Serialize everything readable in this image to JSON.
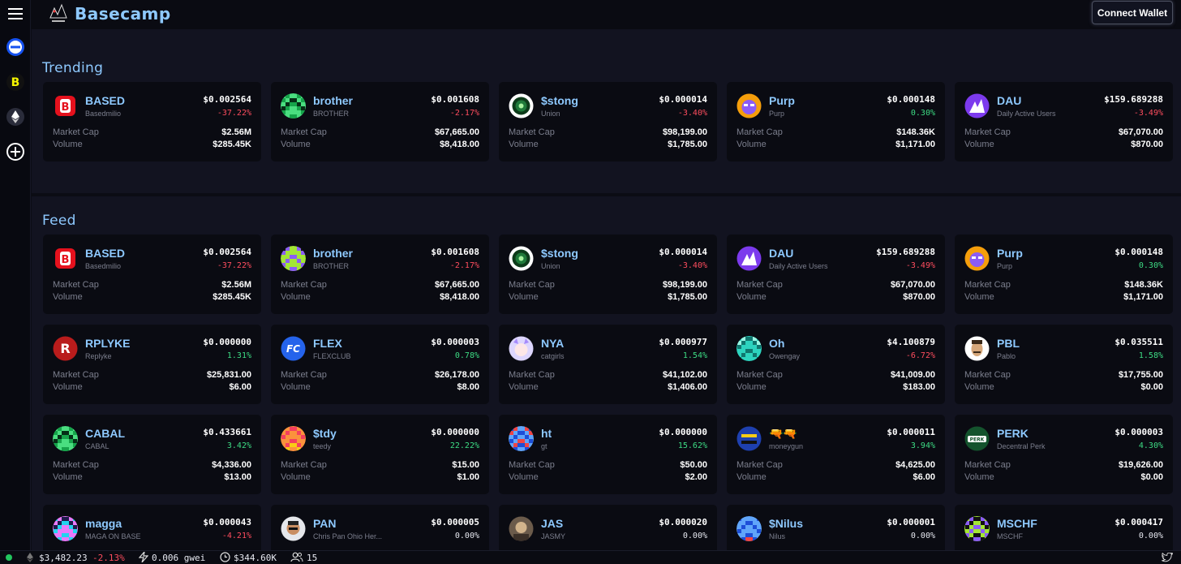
{
  "app": {
    "title": "Basecamp",
    "connect_label": "Connect Wallet"
  },
  "sections": {
    "trending": "Trending",
    "feed": "Feed"
  },
  "labels": {
    "market_cap": "Market Cap",
    "volume": "Volume"
  },
  "trending": [
    {
      "name": "BASED",
      "sub": "Basedmilio",
      "price": "$0.002564",
      "change": "-37.22%",
      "dir": "down",
      "mcap": "$2.56M",
      "vol": "$285.45K",
      "icon": "based-logo-icon"
    },
    {
      "name": "brother",
      "sub": "BROTHER",
      "price": "$0.001608",
      "change": "-2.17%",
      "dir": "down",
      "mcap": "$67,665.00",
      "vol": "$8,418.00",
      "icon": "pixel-avatar-icon"
    },
    {
      "name": "$stong",
      "sub": "Union",
      "price": "$0.000014",
      "change": "-3.40%",
      "dir": "down",
      "mcap": "$98,199.00",
      "vol": "$1,785.00",
      "icon": "stong-logo-icon"
    },
    {
      "name": "Purp",
      "sub": "Purp",
      "price": "$0.000148",
      "change": "0.30%",
      "dir": "up",
      "mcap": "$148.36K",
      "vol": "$1,171.00",
      "icon": "purp-avatar-icon"
    },
    {
      "name": "DAU",
      "sub": "Daily Active Users",
      "price": "$159.689288",
      "change": "-3.49%",
      "dir": "down",
      "mcap": "$67,070.00",
      "vol": "$870.00",
      "icon": "dau-logo-icon"
    }
  ],
  "feed": [
    {
      "name": "BASED",
      "sub": "Basedmilio",
      "price": "$0.002564",
      "change": "-37.22%",
      "dir": "down",
      "mcap": "$2.56M",
      "vol": "$285.45K",
      "icon": "based-logo-icon"
    },
    {
      "name": "brother",
      "sub": "BROTHER",
      "price": "$0.001608",
      "change": "-2.17%",
      "dir": "down",
      "mcap": "$67,665.00",
      "vol": "$8,418.00",
      "icon": "pixel-avatar-icon"
    },
    {
      "name": "$stong",
      "sub": "Union",
      "price": "$0.000014",
      "change": "-3.40%",
      "dir": "down",
      "mcap": "$98,199.00",
      "vol": "$1,785.00",
      "icon": "stong-logo-icon"
    },
    {
      "name": "DAU",
      "sub": "Daily Active Users",
      "price": "$159.689288",
      "change": "-3.49%",
      "dir": "down",
      "mcap": "$67,070.00",
      "vol": "$870.00",
      "icon": "dau-logo-icon"
    },
    {
      "name": "Purp",
      "sub": "Purp",
      "price": "$0.000148",
      "change": "0.30%",
      "dir": "up",
      "mcap": "$148.36K",
      "vol": "$1,171.00",
      "icon": "purp-avatar-icon"
    },
    {
      "name": "RPLYKE",
      "sub": "Replyke",
      "price": "$0.000000",
      "change": "1.31%",
      "dir": "up",
      "mcap": "$25,831.00",
      "vol": "$6.00",
      "icon": "replyke-logo-icon"
    },
    {
      "name": "FLEX",
      "sub": "FLEXCLUB",
      "price": "$0.000003",
      "change": "0.78%",
      "dir": "up",
      "mcap": "$26,178.00",
      "vol": "$8.00",
      "icon": "flex-logo-icon"
    },
    {
      "name": "NYA",
      "sub": "catgirls",
      "price": "$0.000977",
      "change": "1.54%",
      "dir": "up",
      "mcap": "$41,102.00",
      "vol": "$1,406.00",
      "icon": "catgirl-avatar-icon"
    },
    {
      "name": "Oh",
      "sub": "Owengay",
      "price": "$4.100879",
      "change": "-6.72%",
      "dir": "down",
      "mcap": "$41,009.00",
      "vol": "$183.00",
      "icon": "pixel-avatar-icon"
    },
    {
      "name": "PBL",
      "sub": "Pablo",
      "price": "$0.035511",
      "change": "1.58%",
      "dir": "up",
      "mcap": "$17,755.00",
      "vol": "$0.00",
      "icon": "pablo-avatar-icon"
    },
    {
      "name": "CABAL",
      "sub": "CABAL",
      "price": "$0.433661",
      "change": "3.42%",
      "dir": "up",
      "mcap": "$4,336.00",
      "vol": "$13.00",
      "icon": "pixel-avatar-icon"
    },
    {
      "name": "$tdy",
      "sub": "teedy",
      "price": "$0.000000",
      "change": "22.22%",
      "dir": "up",
      "mcap": "$15.00",
      "vol": "$1.00",
      "icon": "pixel-avatar-icon"
    },
    {
      "name": "ht",
      "sub": "gt",
      "price": "$0.000000",
      "change": "15.62%",
      "dir": "up",
      "mcap": "$50.00",
      "vol": "$2.00",
      "icon": "pixel-avatar-icon"
    },
    {
      "name": "🔫🔫",
      "sub": "moneygun",
      "price": "$0.000011",
      "change": "3.94%",
      "dir": "up",
      "mcap": "$4,625.00",
      "vol": "$6.00",
      "icon": "moneygun-avatar-icon"
    },
    {
      "name": "PERK",
      "sub": "Decentral Perk",
      "price": "$0.000003",
      "change": "4.30%",
      "dir": "up",
      "mcap": "$19,626.00",
      "vol": "$0.00",
      "icon": "perk-logo-icon"
    },
    {
      "name": "magga",
      "sub": "MAGA ON BASE",
      "price": "$0.000043",
      "change": "-4.21%",
      "dir": "down",
      "mcap": "",
      "vol": "",
      "icon": "pixel-avatar-icon"
    },
    {
      "name": "PAN",
      "sub": "Chris Pan Ohio Her...",
      "price": "$0.000005",
      "change": "0.00%",
      "dir": "flat",
      "mcap": "",
      "vol": "",
      "icon": "pan-avatar-icon"
    },
    {
      "name": "JAS",
      "sub": "JASMY",
      "price": "$0.000020",
      "change": "0.00%",
      "dir": "flat",
      "mcap": "",
      "vol": "",
      "icon": "jas-avatar-icon"
    },
    {
      "name": "$Nilus",
      "sub": "Nilus",
      "price": "$0.000001",
      "change": "0.00%",
      "dir": "flat",
      "mcap": "",
      "vol": "",
      "icon": "pixel-avatar-icon"
    },
    {
      "name": "MSCHF",
      "sub": "MSCHF",
      "price": "$0.000417",
      "change": "0.00%",
      "dir": "flat",
      "mcap": "",
      "vol": "",
      "icon": "pixel-avatar-icon"
    }
  ],
  "status": {
    "eth_price": "$3,482.23",
    "eth_change": "-2.13%",
    "gas": "0.006 gwei",
    "volume": "$344.60K",
    "users": "15"
  }
}
